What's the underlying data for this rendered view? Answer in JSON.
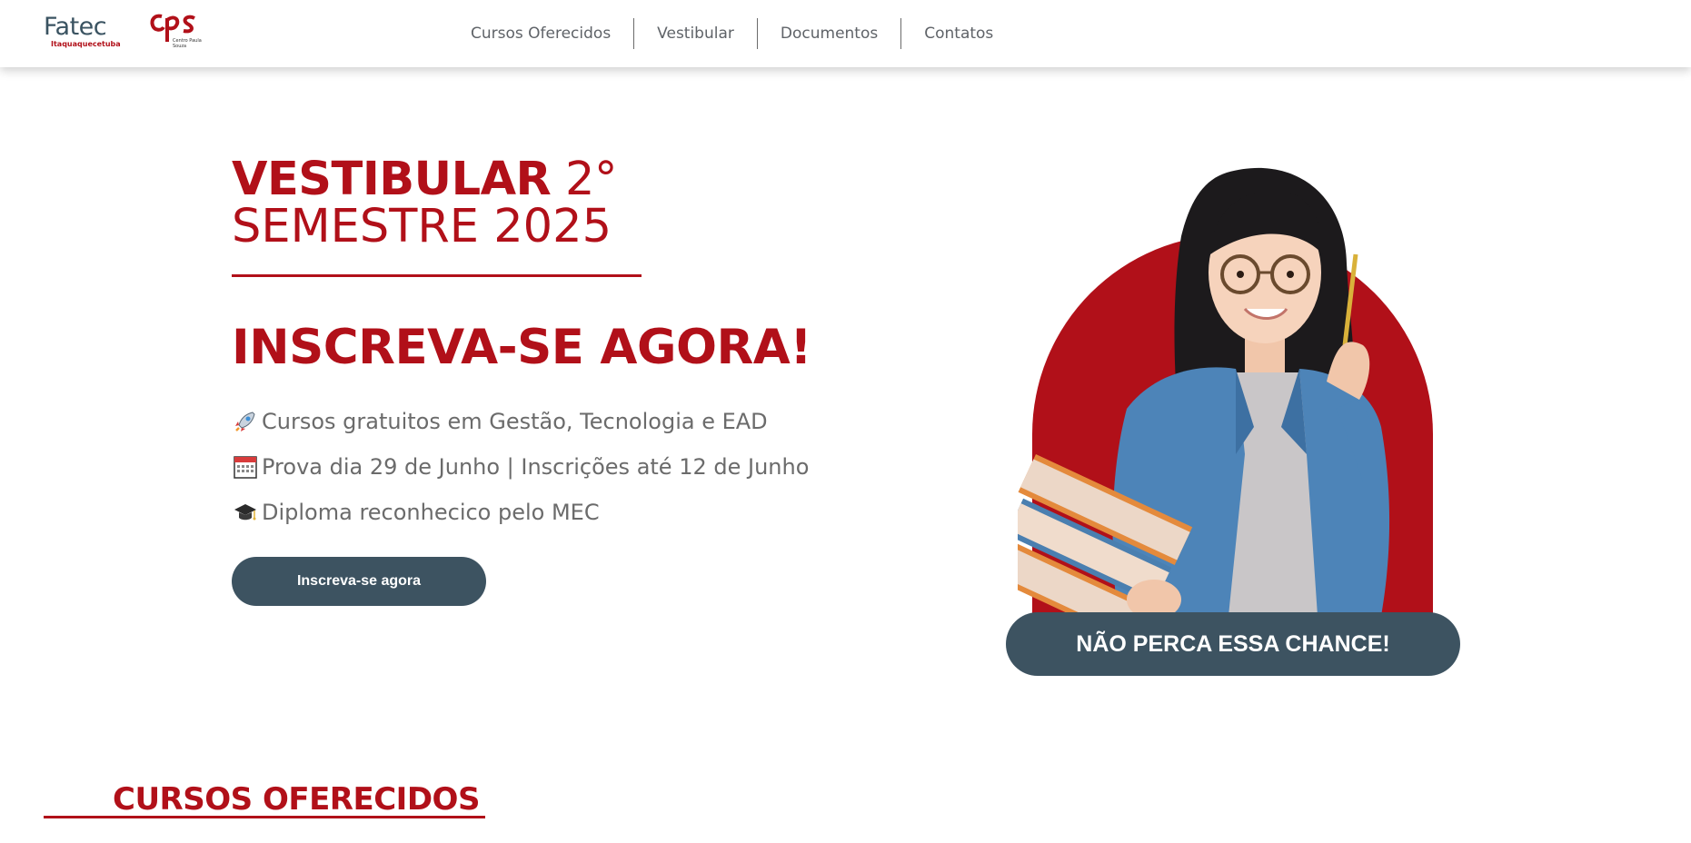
{
  "header": {
    "logo_fatec_name": "Fatec",
    "logo_fatec_city": "Itaquaquecetuba",
    "logo_cps_text": "cps",
    "logo_cps_sub": "Centro Paula Souza",
    "nav": [
      {
        "label": "Cursos Oferecidos"
      },
      {
        "label": "Vestibular"
      },
      {
        "label": "Documentos"
      },
      {
        "label": "Contatos"
      }
    ]
  },
  "hero": {
    "title_bold": "VESTIBULAR",
    "title_degree": " 2°",
    "title_line2": "SEMESTRE 2025",
    "cta_title": "INSCREVA-SE AGORA!",
    "features": [
      {
        "icon": "rocket-icon",
        "text": "Cursos gratuitos em Gestão, Tecnologia e EAD"
      },
      {
        "icon": "calendar-icon",
        "text": "Prova dia 29 de Junho | Inscrições até 12 de Junho"
      },
      {
        "icon": "graduation-cap-icon",
        "text": "Diploma reconhecico pelo MEC"
      }
    ],
    "button_label": "Inscreva-se agora",
    "chance_label": "NÃO PERCA ESSA CHANCE!"
  },
  "courses": {
    "heading": "CURSOS OFERECIDOS"
  },
  "colors": {
    "brand_red": "#b11019",
    "brand_slate": "#3d5361",
    "text_gray": "#6b6b6b"
  }
}
